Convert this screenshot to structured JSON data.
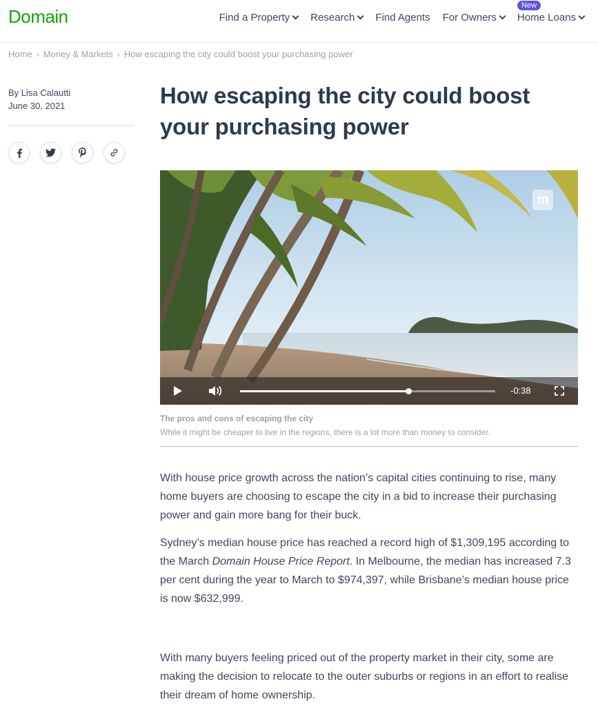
{
  "header": {
    "logo": "Domain",
    "nav": [
      {
        "label": "Find a Property",
        "dropdown": true
      },
      {
        "label": "Research",
        "dropdown": true
      },
      {
        "label": "Find Agents",
        "dropdown": false
      },
      {
        "label": "For Owners",
        "dropdown": true
      },
      {
        "label": "Home Loans",
        "dropdown": true,
        "badge": "New"
      }
    ]
  },
  "breadcrumb": [
    "Home",
    "Money & Markets",
    "How escaping the city could boost your purchasing power"
  ],
  "byline": {
    "author": "By Lisa Calautti",
    "date": "June 30, 2021"
  },
  "share": {
    "icons": [
      "facebook-icon",
      "twitter-icon",
      "pinterest-icon",
      "link-icon"
    ]
  },
  "article": {
    "title": "How escaping the city could boost your purchasing power",
    "video": {
      "brand_mark": "m",
      "time_remaining": "-0:38",
      "progress": 0.66
    },
    "caption": {
      "title": "The pros and cons of escaping the city",
      "description": "While it might be cheaper to live in the regions, there is a lot more than money to consider."
    },
    "p1": "With house price growth across the nation’s capital cities continuing to rise, many home buyers are choosing to escape the city in a bid to increase their purchasing power and gain more bang for their buck.",
    "p2": {
      "before": "Sydney’s median house price has reached a record high of $1,309,195 according to the March ",
      "emphasis": "Domain House Price Report",
      "after": ". In Melbourne, the median has increased 7.3 per cent during the year to March to $974,397, while Brisbane’s median house price is now $632,999."
    },
    "p3": "With many buyers feeling priced out of the property market in their city, some are making the decision to relocate to the outer suburbs or regions in an effort to realise their dream of home ownership."
  },
  "colors": {
    "brand_green": "#0ea800",
    "badge_purple": "#5e53e6",
    "text": "#3c475b",
    "muted": "#9aa1ac"
  }
}
